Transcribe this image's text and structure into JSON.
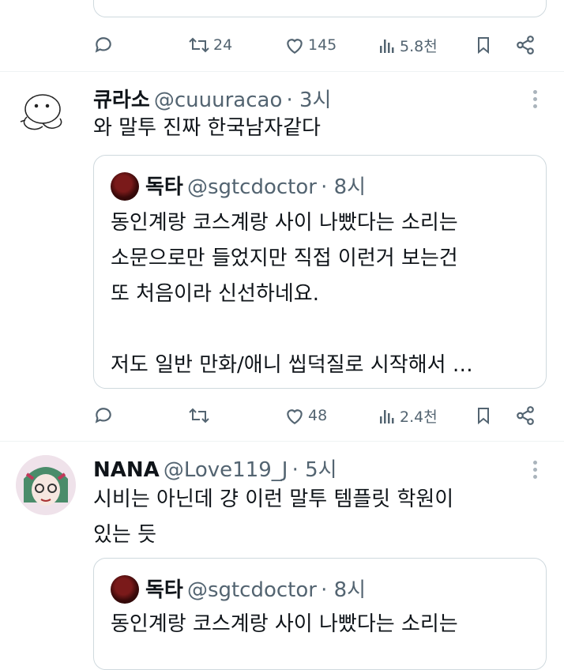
{
  "top_actions": {
    "reply_count": "",
    "retweet_count": "24",
    "like_count": "145",
    "views": "5.8천"
  },
  "tweet1": {
    "name": "큐라소",
    "handle": "@cuuuracao",
    "time": "· 3시",
    "text": "와 말투 진짜 한국남자같다",
    "quote": {
      "name": "독타",
      "handle": "@sgtcdoctor",
      "time": "· 8시",
      "lines": [
        "동인계랑 코스계랑 사이 나빴다는 소리는",
        "소문으로만 들었지만 직접 이런거 보는건",
        "또 처음이라 신선하네요.",
        "",
        "저도 일반 만화/애니 씹덕질로 시작해서 …"
      ]
    },
    "actions": {
      "retweet_count": "",
      "like_count": "48",
      "views": "2.4천"
    }
  },
  "tweet2": {
    "name": "NANA",
    "handle": "@Love119_J",
    "time": "· 5시",
    "lines": [
      "시비는 아닌데 걍 이런 말투 템플릿 학원이",
      "있는 듯"
    ],
    "quote": {
      "name": "독타",
      "handle": "@sgtcdoctor",
      "time": "· 8시",
      "lines": [
        "동인계랑 코스계랑 사이 나빴다는 소리는"
      ]
    }
  },
  "colors": {
    "text": "#0f1419",
    "secondary": "#536471",
    "border": "#cfd9de"
  }
}
